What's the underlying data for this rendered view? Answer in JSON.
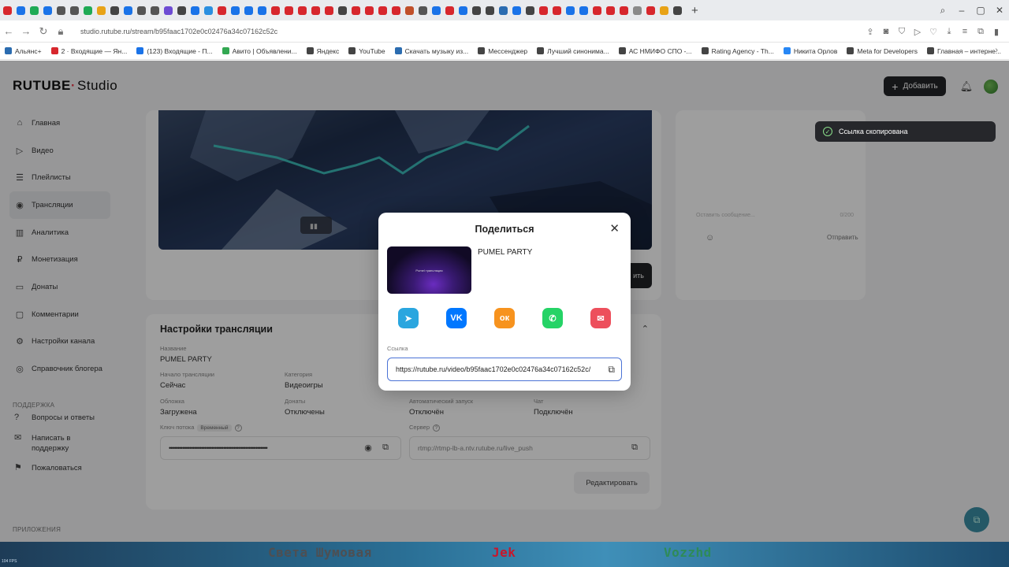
{
  "browser": {
    "tabs_favicons": [
      "#d7272d",
      "#1a73e8",
      "#1faa55",
      "#1a73e8",
      "#555",
      "#555",
      "#1faa55",
      "#e8a317",
      "#444",
      "#1a73e8",
      "#555",
      "#555",
      "#6d4bd3",
      "#444",
      "#1a73e8",
      "#2a8fe0",
      "#d7272d",
      "#1a73e8",
      "#1a73e8",
      "#1a73e8",
      "#d7272d",
      "#d7272d",
      "#d7272d",
      "#d7272d",
      "#d7272d",
      "#444",
      "#d7272d",
      "#d7272d",
      "#d7272d",
      "#d7272d",
      "#c0502a",
      "#555",
      "#1a73e8",
      "#d7272d",
      "#1a73e8",
      "#444",
      "#444",
      "#2b6cb0",
      "#1a73e8",
      "#444",
      "#d7272d",
      "#d7272d",
      "#1a73e8",
      "#1a73e8",
      "#d7272d",
      "#d7272d",
      "#d7272d",
      "#8a8a8a",
      "#d7272d",
      "#e8a317",
      "#444"
    ],
    "new_tab": "+",
    "url": "studio.rutube.ru/stream/b95faac1702e0c02476a34c07162c52c",
    "bookmarks": [
      {
        "label": "Альянс+",
        "color": "#2b6cb0"
      },
      {
        "label": "2 · Входящие — Ян...",
        "color": "#d7272d"
      },
      {
        "label": "(123) Входящие - П...",
        "color": "#1a73e8"
      },
      {
        "label": "Авито | Объявлени...",
        "color": "#33a852"
      },
      {
        "label": "Яндекс",
        "color": "#444"
      },
      {
        "label": "YouTube",
        "color": "#444"
      },
      {
        "label": "Скачать музыку из...",
        "color": "#2b6cb0"
      },
      {
        "label": "Мессенджер",
        "color": "#444"
      },
      {
        "label": "Лучший синонима...",
        "color": "#444"
      },
      {
        "label": "АС НМИФО СПО -...",
        "color": "#444"
      },
      {
        "label": "Rating Agency - Th...",
        "color": "#444"
      },
      {
        "label": "Никита Орлов",
        "color": "#2787f5"
      },
      {
        "label": "Meta for Developers",
        "color": "#444"
      },
      {
        "label": "Главная – интерне...",
        "color": "#444"
      }
    ]
  },
  "app": {
    "logo_main": "RUTUBE",
    "logo_studio": "Studio",
    "add_button": "Добавить",
    "nav": [
      {
        "label": "Главная",
        "icon": "home-icon",
        "glyph": "⌂",
        "active": false
      },
      {
        "label": "Видео",
        "icon": "video-icon",
        "glyph": "▷",
        "active": false
      },
      {
        "label": "Плейлисты",
        "icon": "playlist-icon",
        "glyph": "☰",
        "active": false
      },
      {
        "label": "Трансляции",
        "icon": "broadcast-icon",
        "glyph": "◉",
        "active": true
      },
      {
        "label": "Аналитика",
        "icon": "analytics-icon",
        "glyph": "▥",
        "active": false
      },
      {
        "label": "Монетизация",
        "icon": "monetization-icon",
        "glyph": "₽",
        "active": false
      },
      {
        "label": "Донаты",
        "icon": "donations-icon",
        "glyph": "▭",
        "active": false
      },
      {
        "label": "Комментарии",
        "icon": "comments-icon",
        "glyph": "▢",
        "active": false
      },
      {
        "label": "Настройки канала",
        "icon": "settings-icon",
        "glyph": "⚙",
        "active": false
      },
      {
        "label": "Справочник блогера",
        "icon": "guide-icon",
        "glyph": "◎",
        "active": false
      }
    ],
    "support_label": "ПОДДЕРЖКА",
    "support": [
      {
        "label": "Вопросы и ответы",
        "icon": "faq-icon",
        "glyph": "?"
      },
      {
        "label": "Написать в поддержку",
        "icon": "mail-icon",
        "glyph": "✉"
      },
      {
        "label": "Пожаловаться",
        "icon": "flag-icon",
        "glyph": "⚑"
      }
    ],
    "apps_label": "ПРИЛОЖЕНИЯ",
    "save_button": "ить",
    "chat": {
      "placeholder": "Оставить сообщение...",
      "counter": "0/200",
      "send": "Отправить"
    },
    "settings": {
      "title": "Настройки трансляции",
      "name_label": "Название",
      "name_value": "PUMEL PARTY",
      "start_label": "Начало трансляции",
      "start_value": "Сейчас",
      "category_label": "Категория",
      "category_value": "Видеоигры",
      "cover_label": "Обложка",
      "cover_value": "Загружена",
      "donations_label": "Донаты",
      "donations_value": "Отключены",
      "autostart_label": "Автоматический запуск",
      "autostart_value": "Отключён",
      "chat_label": "Чат",
      "chat_value": "Подключён",
      "key_label": "Ключ потока",
      "key_tag": "Временный",
      "key_value": "••••••••••••••••••••••••••••••••••••••••••••••••••••••••••",
      "server_label": "Сервер",
      "server_value": "rtmp://rtmp-lb-a.ntv.rutube.ru/live_push",
      "edit_button": "Редактировать"
    },
    "toast": "Ссылка скопирована"
  },
  "modal": {
    "title": "Поделиться",
    "video_title": "PUMEL PARTY",
    "thumb_text": "Pumel трансляция",
    "socials": [
      {
        "name": "telegram",
        "color": "#2aa6df",
        "glyph": "➤"
      },
      {
        "name": "vk",
        "color": "#0077ff",
        "glyph": "VK"
      },
      {
        "name": "odnoklassniki",
        "color": "#f7931e",
        "glyph": "ок"
      },
      {
        "name": "whatsapp",
        "color": "#25d366",
        "glyph": "✆"
      },
      {
        "name": "email",
        "color": "#ed4f5c",
        "glyph": "✉"
      }
    ],
    "link_label": "Ссылка",
    "link_value": "https://rutube.ru/video/b95faac1702e0c02476a34c07162c52c/"
  },
  "taskbar": {
    "tiny": "104 FPS",
    "names": [
      {
        "label": "Света Шумовая",
        "color": "#4e4f52"
      },
      {
        "label": "Jek",
        "color": "#c8162b"
      },
      {
        "label": "Vozzhd",
        "color": "#2e8b57"
      }
    ]
  }
}
